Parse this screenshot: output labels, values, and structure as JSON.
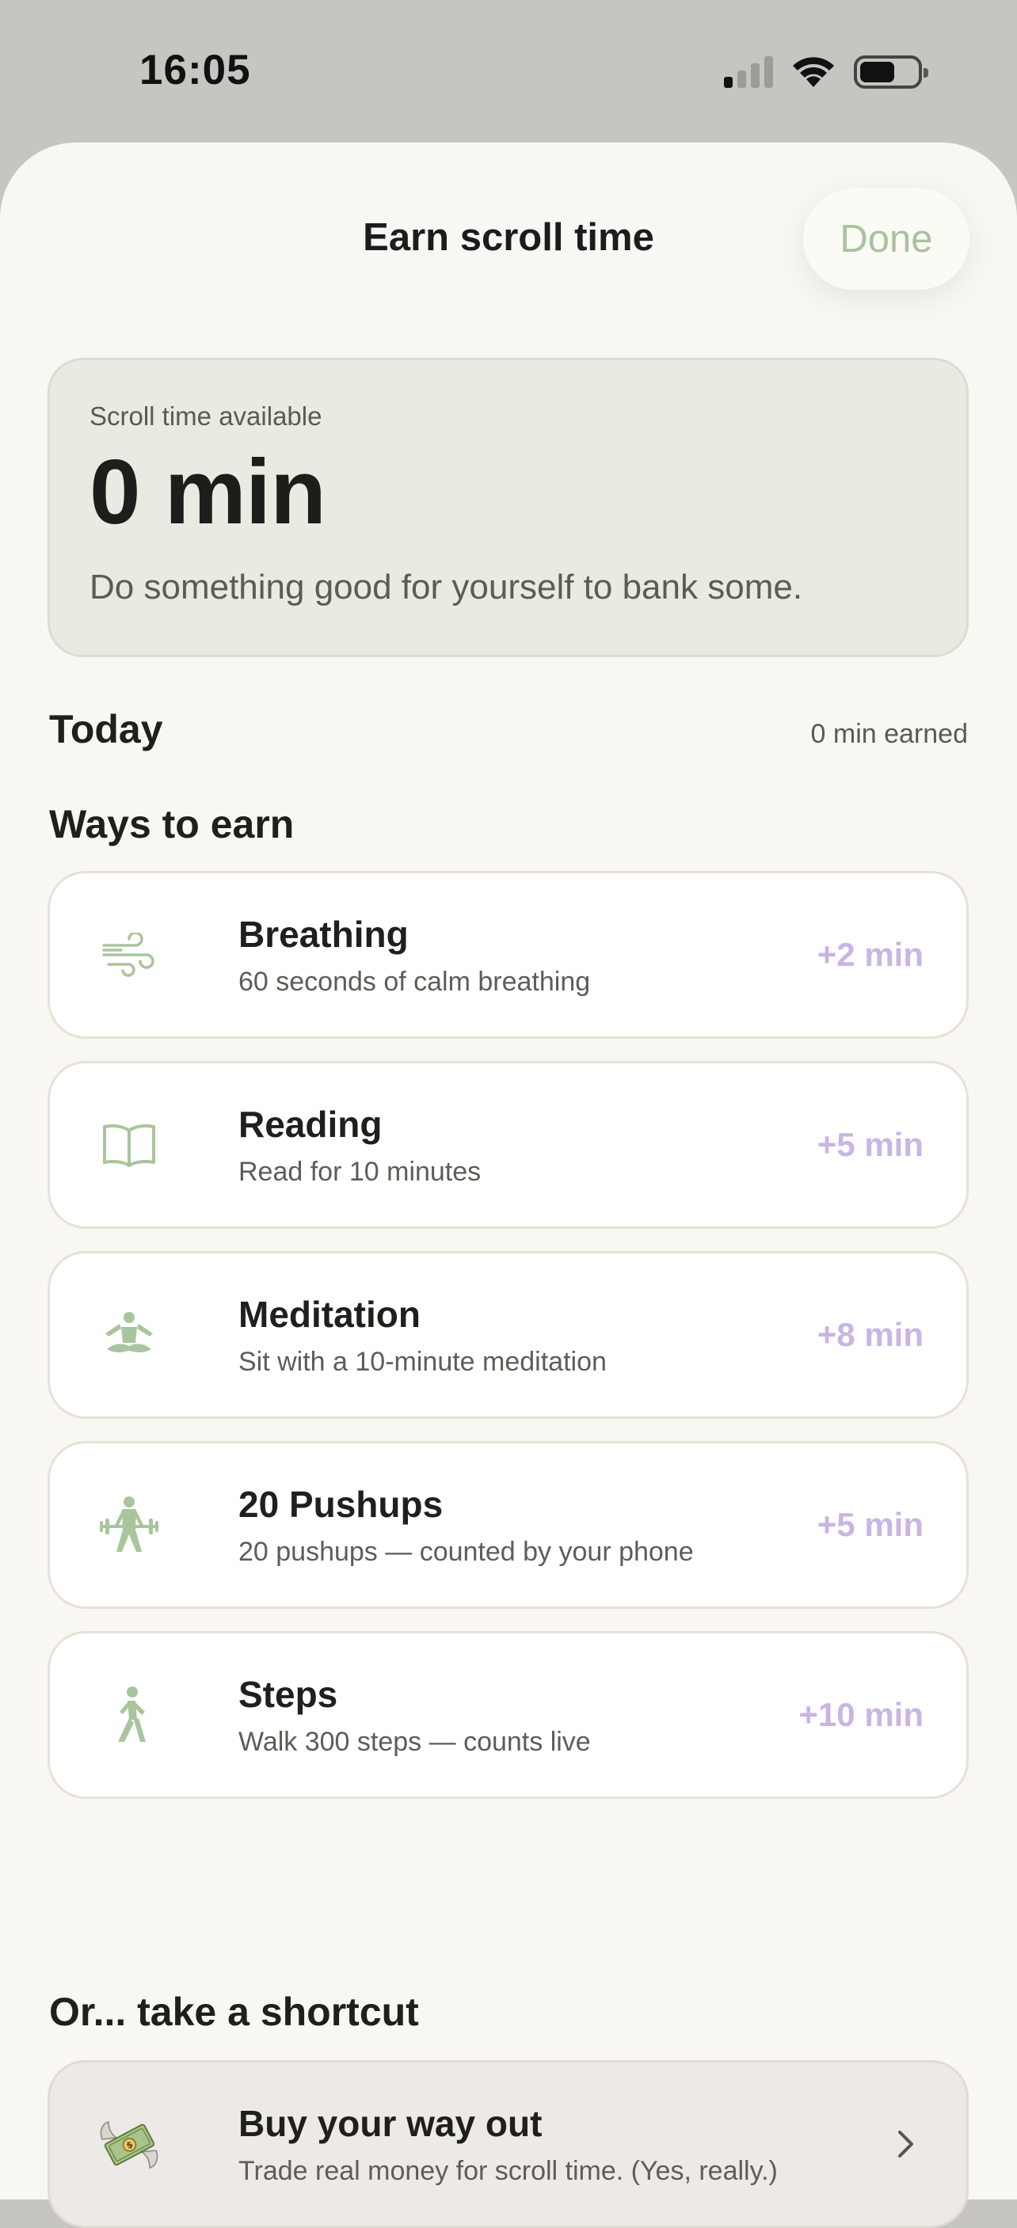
{
  "status_bar": {
    "time": "16:05"
  },
  "header": {
    "title": "Earn scroll time",
    "done_label": "Done"
  },
  "balance": {
    "label": "Scroll time available",
    "value": "0 min",
    "hint": "Do something good for yourself to bank some."
  },
  "today": {
    "label": "Today",
    "earned": "0 min earned"
  },
  "ways": {
    "heading": "Ways to earn",
    "items": [
      {
        "title": "Breathing",
        "description": "60 seconds of calm breathing",
        "reward": "+2 min",
        "icon": "wind-icon"
      },
      {
        "title": "Reading",
        "description": "Read for 10 minutes",
        "reward": "+5 min",
        "icon": "book-icon"
      },
      {
        "title": "Meditation",
        "description": "Sit with a 10-minute meditation",
        "reward": "+8 min",
        "icon": "meditation-icon"
      },
      {
        "title": "20 Pushups",
        "description": "20 pushups — counted by your phone",
        "reward": "+5 min",
        "icon": "weightlifting-icon"
      },
      {
        "title": "Steps",
        "description": "Walk 300 steps — counts live",
        "reward": "+10 min",
        "icon": "walking-icon"
      }
    ]
  },
  "shortcut": {
    "heading": "Or... take a shortcut",
    "title": "Buy your way out",
    "description": "Trade real money for scroll time. (Yes, really.)",
    "icon": "money-with-wings-icon"
  },
  "colors": {
    "accent_green": "#a8c29e",
    "reward_purple": "#c9b5e3",
    "icon_green": "#a9c59d",
    "balance_card": "#e8ebe2",
    "sheet_bg": "#f8f7f3"
  }
}
